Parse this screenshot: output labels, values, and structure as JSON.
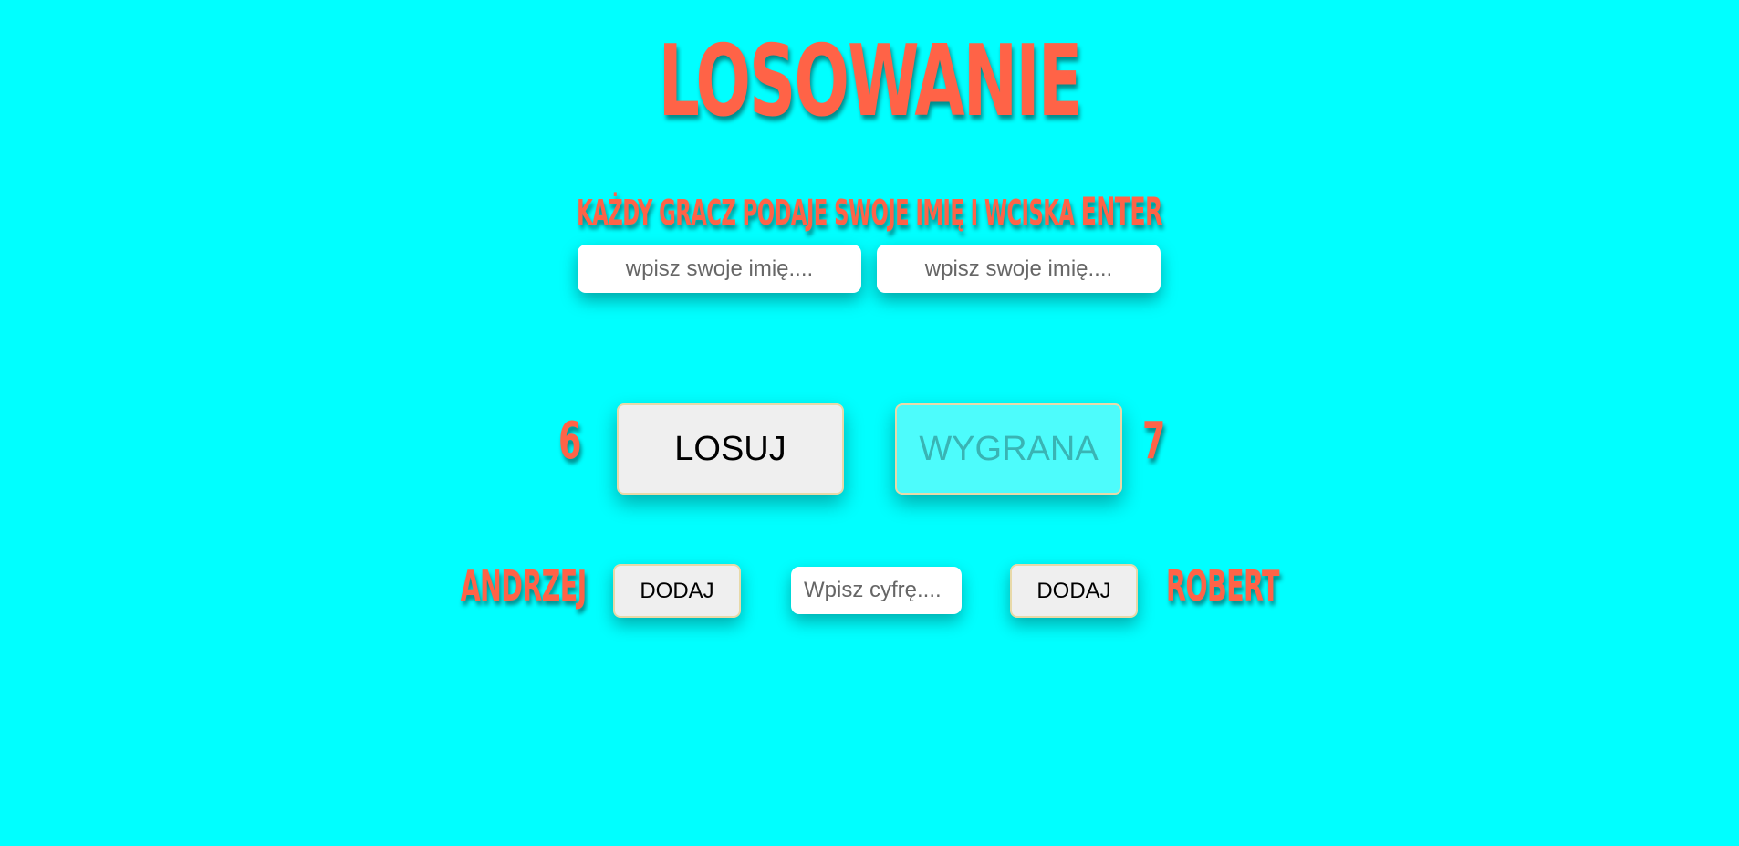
{
  "title": "LOSOWANIE",
  "instruction": {
    "text": "KAŻDY GRACZ PODAJE SWOJE IMIĘ I WCISKA",
    "key": "ENTER"
  },
  "name_inputs": [
    {
      "placeholder": "wpisz swoje imię...."
    },
    {
      "placeholder": "wpisz swoje imię...."
    }
  ],
  "scores": {
    "player1": "6",
    "player2": "7"
  },
  "buttons": {
    "draw": "LOSUJ",
    "win": "WYGRANA",
    "add1": "DODAJ",
    "add2": "DODAJ"
  },
  "players": {
    "player1": "ANDRZEJ",
    "player2": "ROBERT"
  },
  "number_input": {
    "placeholder": "Wpisz cyfrę...."
  },
  "colors": {
    "background": "#00ffff",
    "accent": "#ff6347"
  }
}
